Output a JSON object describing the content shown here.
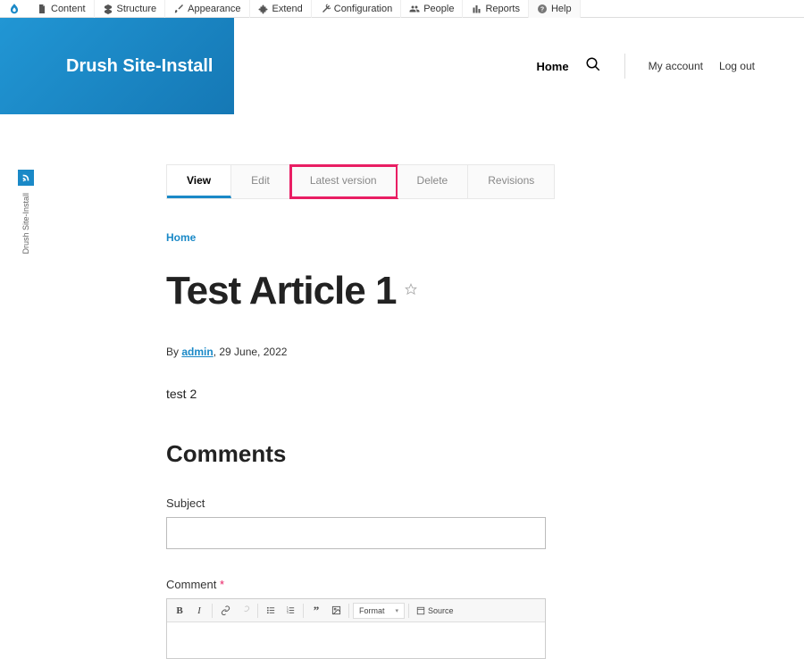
{
  "admin_menu": [
    {
      "label": "Content",
      "icon": "file"
    },
    {
      "label": "Structure",
      "icon": "structure"
    },
    {
      "label": "Appearance",
      "icon": "brush"
    },
    {
      "label": "Extend",
      "icon": "puzzle"
    },
    {
      "label": "Configuration",
      "icon": "wrench"
    },
    {
      "label": "People",
      "icon": "people"
    },
    {
      "label": "Reports",
      "icon": "chart"
    },
    {
      "label": "Help",
      "icon": "help"
    }
  ],
  "site_name": "Drush Site-Install",
  "nav": {
    "home": "Home",
    "my_account": "My account",
    "log_out": "Log out"
  },
  "vertical_badge": "Drush Site-Install",
  "tabs": [
    {
      "label": "View",
      "active": true
    },
    {
      "label": "Edit"
    },
    {
      "label": "Latest version",
      "highlighted": true
    },
    {
      "label": "Delete"
    },
    {
      "label": "Revisions"
    }
  ],
  "breadcrumb": "Home",
  "page_title": "Test Article 1",
  "byline": {
    "by": "By ",
    "author": "admin",
    "date": ", 29 June, 2022"
  },
  "body": "test 2",
  "comments": {
    "heading": "Comments",
    "subject_label": "Subject",
    "comment_label": "Comment",
    "required_mark": "*"
  },
  "editor": {
    "format_label": "Format",
    "source_label": "Source"
  }
}
